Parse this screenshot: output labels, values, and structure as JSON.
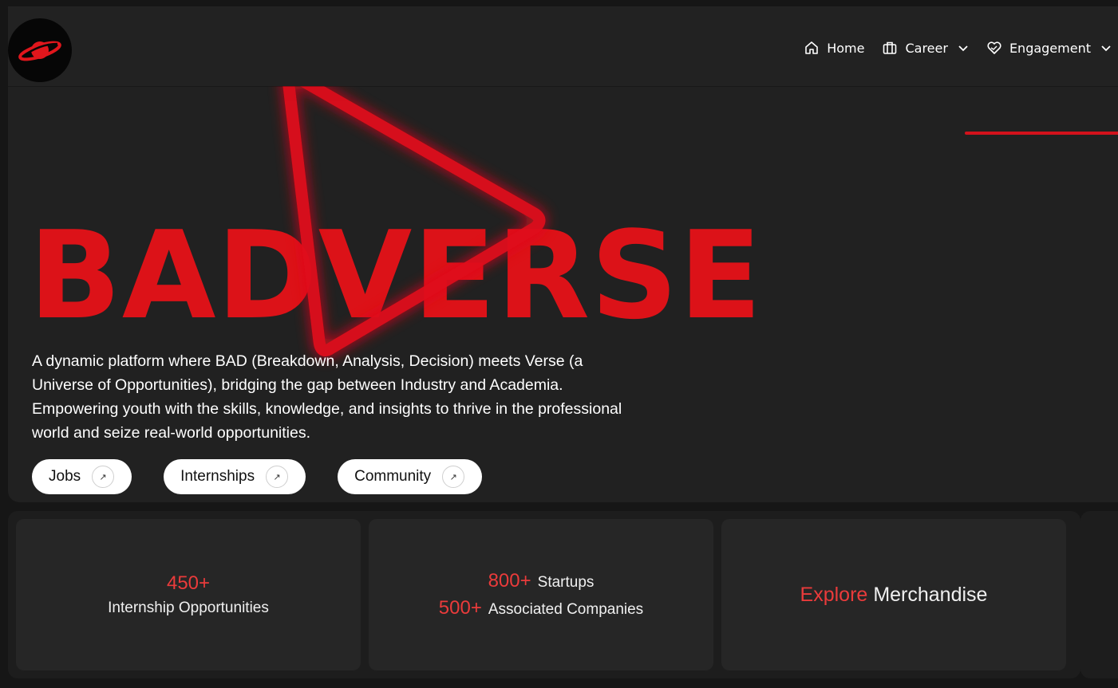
{
  "header": {
    "logo": "planet-logo",
    "nav": [
      {
        "label": "Home",
        "icon": "home-icon",
        "dropdown": false
      },
      {
        "label": "Career",
        "icon": "briefcase-icon",
        "dropdown": true
      },
      {
        "label": "Engagement",
        "icon": "heart-handshake-icon",
        "dropdown": true
      }
    ]
  },
  "hero": {
    "title": "BADVERSE",
    "description": "A dynamic platform where BAD (Breakdown, Analysis, Decision) meets Verse (a Universe of Opportunities), bridging the gap between Industry and Academia. Empowering youth with the skills, knowledge, and insights to thrive in the professional world and seize real-world opportunities.",
    "buttons": [
      {
        "label": "Jobs",
        "icon": "arrow-up-right-icon"
      },
      {
        "label": "Internships",
        "icon": "arrow-up-right-icon"
      },
      {
        "label": "Community",
        "icon": "arrow-up-right-icon"
      }
    ]
  },
  "stats": {
    "internships": {
      "value": "450+",
      "label": "Internship Opportunities"
    },
    "startups": {
      "value": "800+",
      "label": "Startups"
    },
    "companies": {
      "value": "500+",
      "label": "Associated Companies"
    },
    "merch": {
      "accent": "Explore",
      "label": "Merchandise"
    }
  },
  "colors": {
    "accent": "#dc1218",
    "background": "#212121"
  }
}
